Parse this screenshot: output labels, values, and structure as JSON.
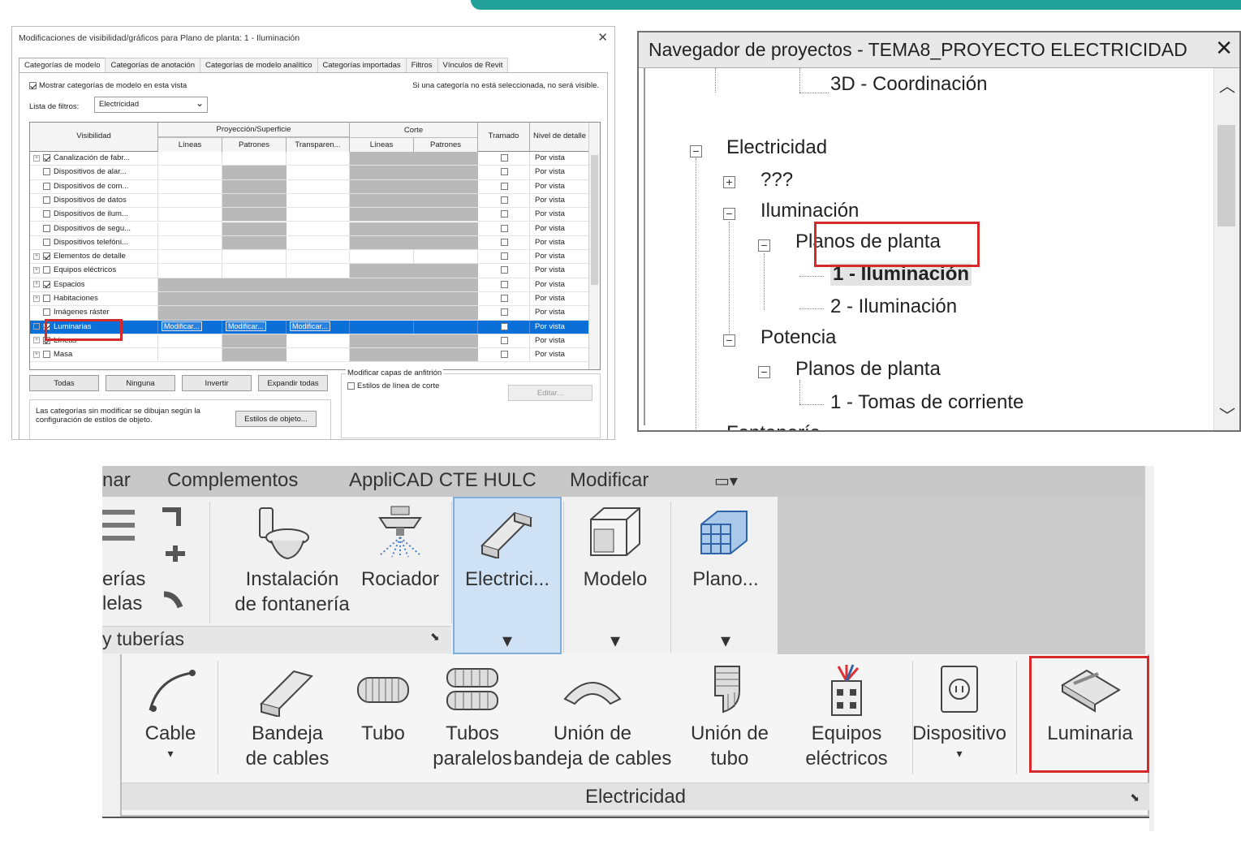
{
  "vis_dialog": {
    "title": "Modificaciones de visibilidad/gráficos para Plano de planta: 1 - Iluminación",
    "close": "✕",
    "tabs": [
      "Categorías de modelo",
      "Categorías de anotación",
      "Categorías de modelo analítico",
      "Categorías importadas",
      "Filtros",
      "Vínculos de Revit"
    ],
    "show_label": "Mostrar categorías de modelo en esta vista",
    "hint": "Si una categoría no está seleccionada, no será visible.",
    "filter_label": "Lista de filtros:",
    "filter_value": "Electricidad",
    "headers": {
      "visibilidad": "Visibilidad",
      "proyeccion": "Proyección/Superficie",
      "corte": "Corte",
      "lineas": "Líneas",
      "patrones": "Patrones",
      "transparencia": "Transparen...",
      "lineas2": "Líneas",
      "patrones2": "Patrones",
      "tramado": "Tramado",
      "nivel": "Nivel de detalle"
    },
    "rows": [
      {
        "name": "Canalización de fabr...",
        "checked": true,
        "expand": true,
        "nivel": "Por vista"
      },
      {
        "name": "Dispositivos de alar...",
        "checked": false,
        "expand": false,
        "nivel": "Por vista"
      },
      {
        "name": "Dispositivos de com...",
        "checked": false,
        "expand": false,
        "nivel": "Por vista"
      },
      {
        "name": "Dispositivos de datos",
        "checked": false,
        "expand": false,
        "nivel": "Por vista"
      },
      {
        "name": "Dispositivos de ilum...",
        "checked": false,
        "expand": false,
        "nivel": "Por vista"
      },
      {
        "name": "Dispositivos de segu...",
        "checked": false,
        "expand": false,
        "nivel": "Por vista"
      },
      {
        "name": "Dispositivos telefóni...",
        "checked": false,
        "expand": false,
        "nivel": "Por vista"
      },
      {
        "name": "Elementos de detalle",
        "checked": true,
        "expand": true,
        "nivel": "Por vista"
      },
      {
        "name": "Equipos eléctricos",
        "checked": false,
        "expand": true,
        "nivel": "Por vista"
      },
      {
        "name": "Espacios",
        "checked": true,
        "expand": true,
        "nivel": "Por vista"
      },
      {
        "name": "Habitaciones",
        "checked": false,
        "expand": true,
        "nivel": "Por vista"
      },
      {
        "name": "Imágenes ráster",
        "checked": false,
        "expand": false,
        "nivel": "Por vista"
      },
      {
        "name": "Luminarias",
        "checked": true,
        "expand": true,
        "nivel": "Por vista",
        "selected": true
      },
      {
        "name": "Líneas",
        "checked": true,
        "expand": true,
        "nivel": "Por vista"
      },
      {
        "name": "Masa",
        "checked": false,
        "expand": true,
        "nivel": "Por vista"
      }
    ],
    "modify": "Modificar...",
    "buttons": {
      "todas": "Todas",
      "ninguna": "Ninguna",
      "invertir": "Invertir",
      "expandir": "Expandir todas"
    },
    "host_label": "Modificar capas de anfitrión",
    "cut_styles": "Estilos de línea de corte",
    "edit": "Editar...",
    "note": "Las categorías sin modificar se dibujan según la configuración de estilos de objeto.",
    "obj_styles": "Estilos de objeto..."
  },
  "browser": {
    "title": "Navegador de proyectos - TEMA8_PROYECTO ELECTRICIDAD",
    "close": "✕",
    "nodes": {
      "coord": "3D - Coordinación",
      "elec": "Electricidad",
      "unk": "???",
      "ilum": "Iluminación",
      "planos1": "Planos de planta",
      "ilum1": "1 - Iluminación",
      "ilum2": "2 - Iluminación",
      "potencia": "Potencia",
      "planos2": "Planos de planta",
      "tomas": "1 - Tomas de corriente",
      "fontaneria": "Fontanería"
    }
  },
  "ribbon": {
    "menu": [
      "nar",
      "Complementos",
      "AppliCAD CTE HULC",
      "Modificar"
    ],
    "upper_labels": {
      "erias": "erías",
      "lelas": "lelas",
      "instalacion": "Instalación",
      "fontaneria": "de fontanería",
      "rociador": "Rociador",
      "electrici": "Electrici...",
      "modelo": "Modelo",
      "plano": "Plano..."
    },
    "panel_label": "y tuberías",
    "lower_buttons": [
      {
        "l1": "Cable",
        "l2": ""
      },
      {
        "l1": "Bandeja",
        "l2": "de cables"
      },
      {
        "l1": "Tubo",
        "l2": ""
      },
      {
        "l1": "Tubos",
        "l2": "paralelos"
      },
      {
        "l1": "Unión de",
        "l2": "bandeja de cables"
      },
      {
        "l1": "Unión de",
        "l2": "tubo"
      },
      {
        "l1": "Equipos",
        "l2": "eléctricos"
      },
      {
        "l1": "Dispositivo",
        "l2": ""
      },
      {
        "l1": "Luminaria",
        "l2": ""
      }
    ],
    "lower_label": "Electricidad",
    "accent": "#d52a2a",
    "highlight": "#cfe1f5"
  }
}
